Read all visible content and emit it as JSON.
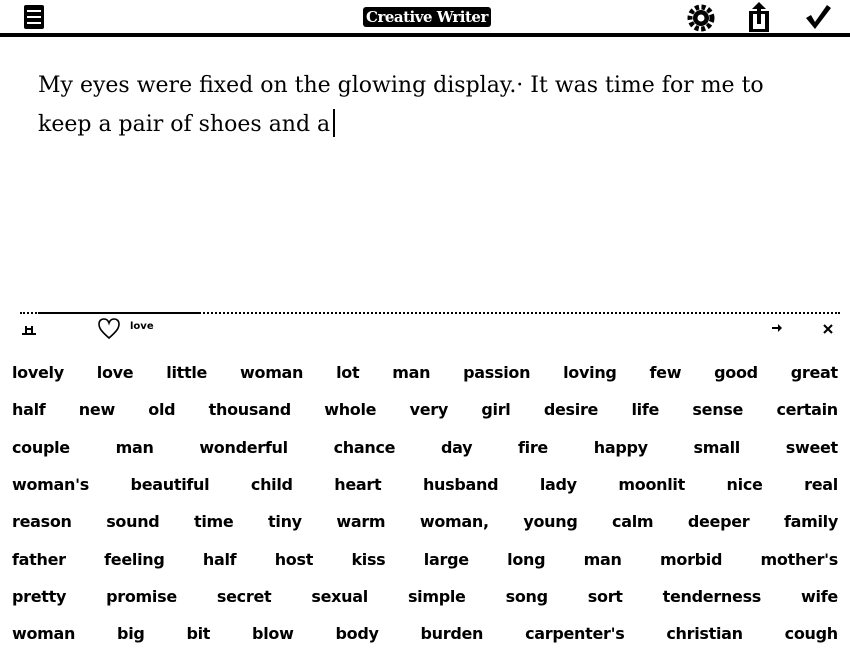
{
  "header": {
    "title": "Creative Writer",
    "icons": [
      "menu-icon",
      "settings-gear-icon",
      "share-icon",
      "checkmark-icon"
    ]
  },
  "editor": {
    "text": "My eyes were fixed on the glowing display.· It was time for me to keep a pair of shoes and a"
  },
  "suggestion_bar": {
    "favorite_label": "love"
  },
  "words": [
    [
      "lovely",
      "love",
      "little",
      "woman",
      "lot",
      "man",
      "passion",
      "loving",
      "few",
      "good",
      "great"
    ],
    [
      "half",
      "new",
      "old",
      "thousand",
      "whole",
      "very",
      "girl",
      "desire",
      "life",
      "sense",
      "certain"
    ],
    [
      "couple",
      "man",
      "wonderful",
      "chance",
      "day",
      "fire",
      "happy",
      "small",
      "sweet"
    ],
    [
      "woman's",
      "beautiful",
      "child",
      "heart",
      "husband",
      "lady",
      "moonlit",
      "nice",
      "real"
    ],
    [
      "reason",
      "sound",
      "time",
      "tiny",
      "warm",
      "woman,",
      "young",
      "calm",
      "deeper",
      "family"
    ],
    [
      "father",
      "feeling",
      "half",
      "host",
      "kiss",
      "large",
      "long",
      "man",
      "morbid",
      "mother's"
    ],
    [
      "pretty",
      "promise",
      "secret",
      "sexual",
      "simple",
      "song",
      "sort",
      "tenderness",
      "wife"
    ],
    [
      "woman",
      "big",
      "bit",
      "blow",
      "body",
      "burden",
      "carpenter's",
      "christian",
      "cough"
    ]
  ]
}
